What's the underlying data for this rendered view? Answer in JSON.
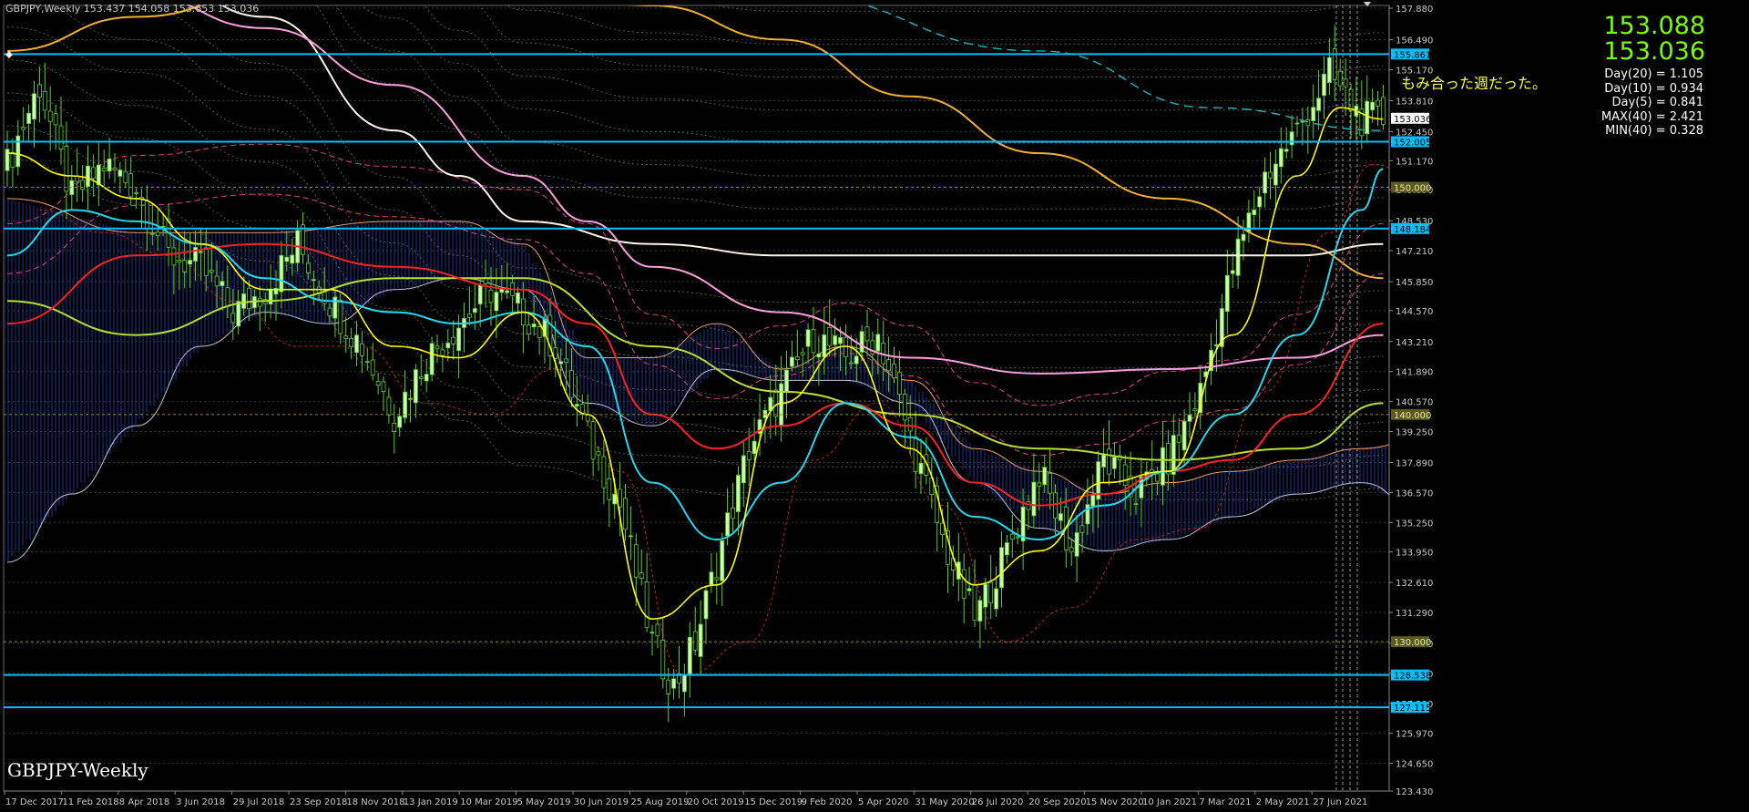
{
  "header": {
    "symbol": "GBPJPY,Weekly",
    "ohlc": "153.437 154.058 153.653 153.036"
  },
  "watermark": "GBPJPY-Weekly",
  "price_display": {
    "bid": "153.088",
    "last": "153.036"
  },
  "annotation": "もみ合った週だった。",
  "stats": [
    "Day(20) = 1.105",
    "Day(10) = 0.934",
    "Day(5) = 0.841",
    "MAX(40) = 2.421",
    "MIN(40) = 0.328"
  ],
  "colors": {
    "background": "#000000",
    "candle_body": "#ccffaa",
    "candle_wick": "#5bd02a",
    "hline": "#00bfff",
    "level_label_bg": "#00bfff",
    "round_label_bg": "#5a5a22",
    "ma_yellow": "#ffff00",
    "ma_cyan": "#22d8f0",
    "ma_red": "#ff2020",
    "ma_yellowgreen": "#b8e030",
    "ma_pink": "#ff9fe0",
    "ma_white": "#fff5e6",
    "ma_orange": "#f5b030"
  },
  "chart_data": {
    "type": "candlestick",
    "ylim": [
      123.43,
      158.0
    ],
    "y_ticks": [
      "157.880",
      "156.490",
      "155.170",
      "153.810",
      "152.450",
      "151.170",
      "149.890",
      "148.530",
      "147.210",
      "145.850",
      "144.570",
      "143.210",
      "141.890",
      "140.570",
      "139.250",
      "137.890",
      "136.570",
      "135.250",
      "133.950",
      "132.610",
      "131.290",
      "129.930",
      "128.610",
      "127.290",
      "125.970",
      "124.650",
      "123.430"
    ],
    "x_labels": [
      "17 Dec 2017",
      "11 Feb 2018",
      "8 Apr 2018",
      "3 Jun 2018",
      "29 Jul 2018",
      "23 Sep 2018",
      "18 Nov 2018",
      "13 Jan 2019",
      "10 Mar 2019",
      "5 May 2019",
      "30 Jun 2019",
      "25 Aug 2019",
      "20 Oct 2019",
      "15 Dec 2019",
      "9 Feb 2020",
      "5 Apr 2020",
      "31 May 2020",
      "26 Jul 2020",
      "20 Sep 2020",
      "15 Nov 2020",
      "10 Jan 2021",
      "7 Mar 2021",
      "2 May 2021",
      "27 Jun 2021"
    ],
    "horizontal_levels": [
      {
        "value": 155.861,
        "label": "155.861",
        "style": "line"
      },
      {
        "value": 152.005,
        "label": "152.005",
        "style": "line"
      },
      {
        "value": 150.0,
        "label": "150.000",
        "style": "round"
      },
      {
        "value": 148.184,
        "label": "148.184",
        "style": "line"
      },
      {
        "value": 140.0,
        "label": "140.000",
        "style": "round"
      },
      {
        "value": 130.0,
        "label": "130.000",
        "style": "round"
      },
      {
        "value": 128.538,
        "label": "128.538",
        "style": "line"
      },
      {
        "value": 127.115,
        "label": "127.115",
        "style": "line"
      }
    ],
    "current_price": {
      "value": 153.036,
      "label": "153.036"
    },
    "close_path": [
      [
        0,
        151.0
      ],
      [
        6,
        154.5
      ],
      [
        12,
        149.5
      ],
      [
        18,
        151.0
      ],
      [
        24,
        150.0
      ],
      [
        30,
        147.0
      ],
      [
        36,
        146.5
      ],
      [
        42,
        144.5
      ],
      [
        48,
        145.5
      ],
      [
        54,
        147.5
      ],
      [
        60,
        145.0
      ],
      [
        66,
        143.0
      ],
      [
        72,
        140.0
      ],
      [
        78,
        142.5
      ],
      [
        84,
        144.0
      ],
      [
        90,
        145.5
      ],
      [
        96,
        144.5
      ],
      [
        102,
        143.0
      ],
      [
        108,
        139.0
      ],
      [
        114,
        136.0
      ],
      [
        120,
        130.0
      ],
      [
        124,
        128.0
      ],
      [
        128,
        130.0
      ],
      [
        132,
        133.5
      ],
      [
        138,
        138.5
      ],
      [
        144,
        141.0
      ],
      [
        150,
        143.5
      ],
      [
        156,
        142.5
      ],
      [
        162,
        143.5
      ],
      [
        168,
        139.0
      ],
      [
        174,
        134.5
      ],
      [
        180,
        131.0
      ],
      [
        186,
        134.0
      ],
      [
        192,
        137.5
      ],
      [
        198,
        134.0
      ],
      [
        204,
        138.0
      ],
      [
        210,
        136.5
      ],
      [
        216,
        138.0
      ],
      [
        222,
        141.0
      ],
      [
        228,
        146.5
      ],
      [
        234,
        150.5
      ],
      [
        240,
        152.5
      ],
      [
        246,
        155.0
      ],
      [
        252,
        153.0
      ],
      [
        256,
        153.0
      ]
    ],
    "ma_paths": {
      "yellow": [
        [
          0,
          151.5
        ],
        [
          12,
          150.5
        ],
        [
          24,
          149.5
        ],
        [
          36,
          147.5
        ],
        [
          48,
          145.5
        ],
        [
          60,
          145.5
        ],
        [
          72,
          143.0
        ],
        [
          84,
          142.5
        ],
        [
          96,
          144.5
        ],
        [
          108,
          140.0
        ],
        [
          120,
          131.0
        ],
        [
          132,
          132.5
        ],
        [
          144,
          140.5
        ],
        [
          156,
          143.0
        ],
        [
          168,
          138.5
        ],
        [
          180,
          132.5
        ],
        [
          192,
          134.0
        ],
        [
          204,
          137.0
        ],
        [
          216,
          137.5
        ],
        [
          228,
          143.5
        ],
        [
          240,
          150.5
        ],
        [
          248,
          153.5
        ],
        [
          256,
          153.0
        ]
      ],
      "cyan": [
        [
          0,
          147.0
        ],
        [
          12,
          149.0
        ],
        [
          24,
          148.5
        ],
        [
          36,
          147.5
        ],
        [
          48,
          146.0
        ],
        [
          60,
          145.0
        ],
        [
          72,
          144.5
        ],
        [
          84,
          144.0
        ],
        [
          96,
          144.5
        ],
        [
          108,
          143.0
        ],
        [
          120,
          137.0
        ],
        [
          132,
          134.5
        ],
        [
          144,
          137.0
        ],
        [
          156,
          140.5
        ],
        [
          168,
          139.0
        ],
        [
          180,
          135.5
        ],
        [
          192,
          134.5
        ],
        [
          204,
          136.0
        ],
        [
          216,
          137.5
        ],
        [
          228,
          140.0
        ],
        [
          240,
          143.5
        ],
        [
          252,
          149.0
        ],
        [
          256,
          150.8
        ]
      ],
      "red": [
        [
          0,
          144.0
        ],
        [
          24,
          147.0
        ],
        [
          48,
          147.5
        ],
        [
          72,
          146.5
        ],
        [
          96,
          145.5
        ],
        [
          108,
          144.0
        ],
        [
          120,
          140.0
        ],
        [
          132,
          138.5
        ],
        [
          144,
          139.5
        ],
        [
          156,
          140.5
        ],
        [
          168,
          139.5
        ],
        [
          180,
          137.0
        ],
        [
          192,
          136.0
        ],
        [
          204,
          136.5
        ],
        [
          216,
          137.5
        ],
        [
          228,
          138.0
        ],
        [
          240,
          140.0
        ],
        [
          256,
          144.0
        ]
      ],
      "yellowgreen": [
        [
          0,
          145.0
        ],
        [
          24,
          143.5
        ],
        [
          48,
          145.0
        ],
        [
          72,
          146.0
        ],
        [
          96,
          146.0
        ],
        [
          120,
          143.0
        ],
        [
          144,
          141.0
        ],
        [
          168,
          140.0
        ],
        [
          192,
          138.5
        ],
        [
          216,
          138.0
        ],
        [
          240,
          138.5
        ],
        [
          256,
          140.5
        ]
      ],
      "pink": [
        [
          0,
          160.0
        ],
        [
          24,
          158.5
        ],
        [
          48,
          157.0
        ],
        [
          72,
          154.5
        ],
        [
          96,
          150.5
        ],
        [
          108,
          148.5
        ],
        [
          120,
          146.5
        ],
        [
          144,
          144.5
        ],
        [
          168,
          142.5
        ],
        [
          192,
          141.8
        ],
        [
          216,
          142.0
        ],
        [
          240,
          142.5
        ],
        [
          256,
          143.5
        ]
      ],
      "white": [
        [
          0,
          162.0
        ],
        [
          24,
          160.0
        ],
        [
          48,
          157.5
        ],
        [
          72,
          152.5
        ],
        [
          84,
          150.5
        ],
        [
          96,
          148.5
        ],
        [
          120,
          147.5
        ],
        [
          144,
          147.0
        ],
        [
          168,
          147.0
        ],
        [
          192,
          147.0
        ],
        [
          216,
          147.0
        ],
        [
          240,
          147.0
        ],
        [
          256,
          147.5
        ]
      ],
      "orange": [
        [
          0,
          156.0
        ],
        [
          24,
          157.5
        ],
        [
          48,
          158.5
        ],
        [
          72,
          159.0
        ],
        [
          96,
          158.8
        ],
        [
          120,
          158.0
        ],
        [
          144,
          156.5
        ],
        [
          168,
          154.0
        ],
        [
          192,
          151.5
        ],
        [
          216,
          149.5
        ],
        [
          240,
          147.5
        ],
        [
          256,
          146.0
        ]
      ],
      "teal_dashed": [
        [
          96,
          160.0
        ],
        [
          144,
          158.5
        ],
        [
          192,
          156.0
        ],
        [
          224,
          153.5
        ],
        [
          256,
          152.5
        ]
      ]
    },
    "cloud": {
      "upper": [
        [
          0,
          149.5
        ],
        [
          24,
          148.0
        ],
        [
          48,
          148.0
        ],
        [
          72,
          148.5
        ],
        [
          84,
          148.5
        ],
        [
          96,
          147.5
        ],
        [
          108,
          142.5
        ],
        [
          120,
          142.5
        ],
        [
          132,
          144.0
        ],
        [
          144,
          142.0
        ],
        [
          156,
          143.0
        ],
        [
          168,
          141.5
        ],
        [
          180,
          138.5
        ],
        [
          192,
          137.5
        ],
        [
          204,
          136.5
        ],
        [
          216,
          137.0
        ],
        [
          228,
          137.5
        ],
        [
          240,
          138.0
        ],
        [
          252,
          138.5
        ],
        [
          264,
          139.0
        ],
        [
          276,
          142.0
        ],
        [
          288,
          146.5
        ],
        [
          300,
          150.0
        ],
        [
          312,
          152.0
        ],
        [
          318,
          152.2
        ]
      ],
      "lower": [
        [
          0,
          133.5
        ],
        [
          12,
          136.5
        ],
        [
          24,
          139.5
        ],
        [
          36,
          143.0
        ],
        [
          48,
          144.5
        ],
        [
          60,
          144.0
        ],
        [
          72,
          145.5
        ],
        [
          84,
          146.0
        ],
        [
          96,
          145.5
        ],
        [
          108,
          140.5
        ],
        [
          120,
          139.5
        ],
        [
          132,
          142.0
        ],
        [
          144,
          141.5
        ],
        [
          156,
          141.5
        ],
        [
          168,
          140.5
        ],
        [
          180,
          137.0
        ],
        [
          192,
          135.0
        ],
        [
          204,
          134.0
        ],
        [
          216,
          134.5
        ],
        [
          228,
          135.5
        ],
        [
          240,
          136.5
        ],
        [
          252,
          137.0
        ],
        [
          264,
          135.5
        ],
        [
          276,
          139.0
        ],
        [
          288,
          142.5
        ],
        [
          300,
          144.5
        ],
        [
          312,
          144.5
        ],
        [
          318,
          144.5
        ]
      ]
    }
  }
}
